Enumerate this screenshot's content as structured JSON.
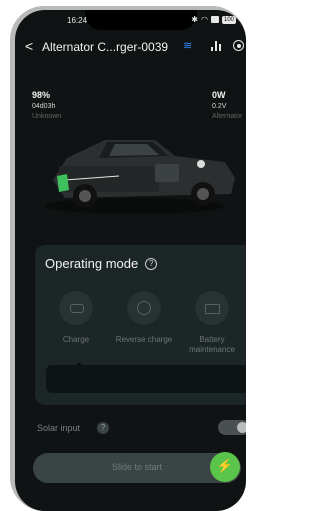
{
  "status_bar": {
    "time": "16:24",
    "battery": "100"
  },
  "header": {
    "title": "Alternator C...rger-0039"
  },
  "stats": {
    "left": {
      "value": "98%",
      "sub": "04d03h",
      "caption": "Unknown"
    },
    "right": {
      "value": "0W",
      "sub": "0.2V",
      "caption": "Alternator"
    }
  },
  "operating_mode": {
    "title": "Operating mode",
    "modes": [
      {
        "label": "Charge",
        "icon": "car-icon"
      },
      {
        "label": "Reverse charge",
        "icon": "reverse-charge-icon"
      },
      {
        "label": "Battery maintenance",
        "icon": "battery-icon"
      }
    ]
  },
  "solar": {
    "label": "Solar input",
    "enabled": true
  },
  "slide": {
    "label": "Slide to start"
  },
  "colors": {
    "background": "#101313",
    "card": "#1d2626",
    "accent_green": "#5bc44a",
    "wifi_blue": "#2f8dff"
  }
}
